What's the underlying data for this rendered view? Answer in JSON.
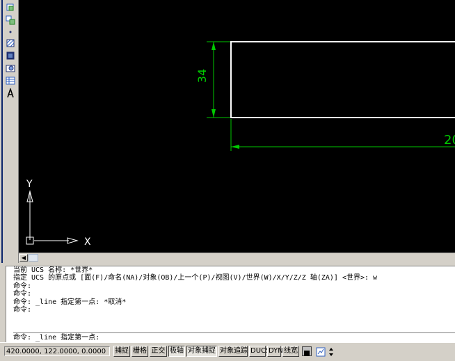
{
  "drawing": {
    "dim_vertical": "34",
    "dim_horizontal": "20",
    "ucs_y_label": "Y",
    "ucs_x_label": "X"
  },
  "command_window": {
    "history": [
      "当前 UCS 名称: *世界*",
      "指定 UCS 的原点或 [面(F)/命名(NA)/对象(OB)/上一个(P)/视图(V)/世界(W)/X/Y/Z/Z 轴(ZA)] <世界>: w",
      "命令:",
      "命令:",
      "命令: _line 指定第一点: *取消*",
      "命令:"
    ],
    "prompt": "命令: _line 指定第一点:"
  },
  "status_bar": {
    "coordinates": "420.0000, 122.0000, 0.0000",
    "snap": "捕捉",
    "grid": "栅格",
    "ortho": "正交",
    "polar": "极轴",
    "osnap": "对象捕捉",
    "otrack": "对象追踪",
    "ducs": "DUCS",
    "dyn": "DYN",
    "lweight": "线宽"
  },
  "colors": {
    "canvas": "#000000",
    "geometry": "#ffffff",
    "dimension": "#00c800"
  }
}
